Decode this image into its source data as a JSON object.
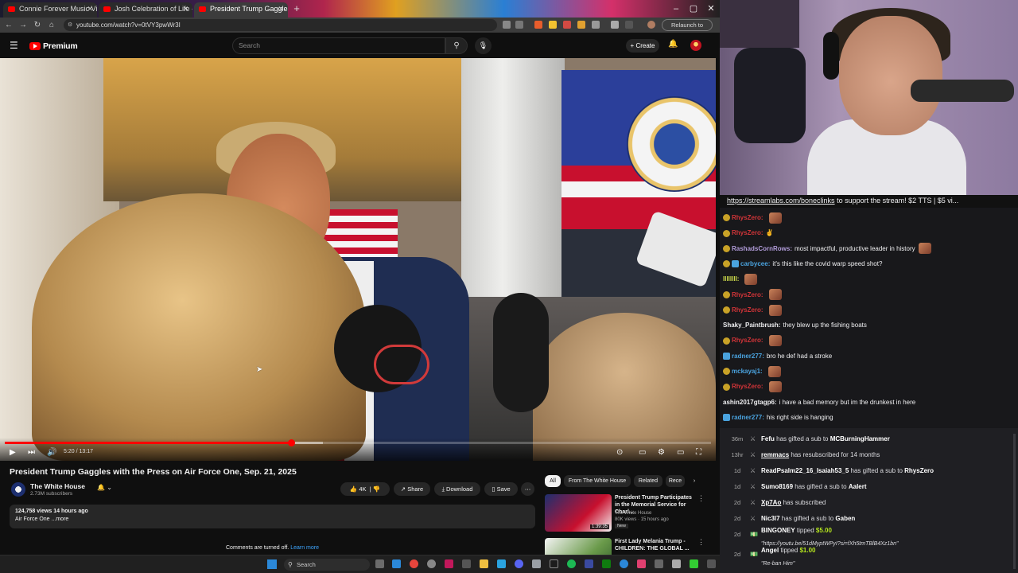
{
  "browser": {
    "tabs": [
      {
        "title": "Connie Forever Music Video -"
      },
      {
        "title": "Josh Celebration of Life - YouT"
      },
      {
        "title": "President Trump Gaggles w"
      }
    ],
    "url": "youtube.com/watch?v=0tVY3pwWr3I",
    "relaunch_label": "Relaunch to update",
    "new_tab_icon": "plus-icon"
  },
  "youtube": {
    "logo_text": "Premium",
    "search_placeholder": "Search",
    "create_label": "Create",
    "video": {
      "progress": 0.405,
      "buffered": 0.45,
      "time": "5:20 / 13:17"
    },
    "title": "President Trump Gaggles with the Press on Air Force One, Sep. 21, 2025",
    "channel": {
      "name": "The White House",
      "subscribers": "2.73M subscribers"
    },
    "actions": {
      "likes": "4K",
      "share": "Share",
      "download": "Download",
      "save": "Save"
    },
    "description": {
      "meta": "124,758 views  14 hours ago",
      "text": "Air Force One ...more"
    },
    "comments_off": "Comments are turned off.",
    "learn_more": "Learn more",
    "chips": [
      "All",
      "From The White House",
      "Related",
      "Rece"
    ],
    "related": [
      {
        "title": "President Trump Participates in the Memorial Service for Charl...",
        "channel": "The White House",
        "views": "80K views · 15 hours ago",
        "badge": "New",
        "duration": "1:39:35"
      },
      {
        "title": "First Lady Melania Trump - CHILDREN: THE GLOBAL ...",
        "channel": "",
        "views": "",
        "badge": "",
        "duration": ""
      }
    ]
  },
  "chat": {
    "banner_link": "https://streamlabs.com/boneclinks",
    "banner_text": " to support the stream! $2 TTS | $5 vi...",
    "messages": [
      {
        "user": "RhysZero:",
        "text": "",
        "user_color": "#d13438",
        "badge": "gold",
        "emote": true
      },
      {
        "user": "RhysZero:",
        "text": "✌",
        "user_color": "#d13438",
        "badge": "gold",
        "emote": false
      },
      {
        "user": "RashadsCornRows:",
        "text": "most impactful, productive leader in history",
        "user_color": "#b19cd9",
        "badge": "gold",
        "emote": true
      },
      {
        "user": "carbycee:",
        "text": "it's this like the covid warp speed shot?",
        "user_color": "#4aa3df",
        "badge": "both",
        "emote": false
      },
      {
        "user": "IIIIIIII:",
        "text": "",
        "user_color": "#c9d64a",
        "badge": "none",
        "emote": true
      },
      {
        "user": "RhysZero:",
        "text": "",
        "user_color": "#d13438",
        "badge": "gold",
        "emote": true
      },
      {
        "user": "RhysZero:",
        "text": "",
        "user_color": "#d13438",
        "badge": "gold",
        "emote": true
      },
      {
        "user": "Shaky_Paintbrush:",
        "text": "they blew up the fishing boats",
        "user_color": "#efeff1",
        "badge": "none",
        "emote": false
      },
      {
        "user": "RhysZero:",
        "text": "",
        "user_color": "#d13438",
        "badge": "gold",
        "emote": true
      },
      {
        "user": "radner277:",
        "text": "bro he def had a stroke",
        "user_color": "#4aa3df",
        "badge": "blue",
        "emote": false
      },
      {
        "user": "mckayaj1:",
        "text": "",
        "user_color": "#4aa3df",
        "badge": "gold",
        "emote": true
      },
      {
        "user": "RhysZero:",
        "text": "",
        "user_color": "#d13438",
        "badge": "gold",
        "emote": true
      },
      {
        "user": "ashin2017gtagp6:",
        "text": "i have a bad memory but im the drunkest in here",
        "user_color": "#efeff1",
        "badge": "none",
        "emote": false
      },
      {
        "user": "radner277:",
        "text": "his right side is hanging",
        "user_color": "#4aa3df",
        "badge": "blue",
        "emote": false
      }
    ]
  },
  "events": [
    {
      "time": "36m",
      "user": "Fefu",
      "mid": " has gifted a sub to ",
      "target": "MCBurningHammer",
      "extra": ""
    },
    {
      "time": "13hr",
      "user": "remmacs",
      "mid": " has resubscribed for 14 months",
      "target": "",
      "extra": "",
      "underline": true
    },
    {
      "time": "1d",
      "user": "ReadPsalm22_16_Isaiah53_5",
      "mid": " has gifted a sub to ",
      "target": "RhysZero",
      "extra": ""
    },
    {
      "time": "1d",
      "user": "Sumo8169",
      "mid": " has gifted a sub to ",
      "target": "Aalert",
      "extra": ""
    },
    {
      "time": "2d",
      "user": "Xp7Ao",
      "mid": " has subscribed",
      "target": "",
      "extra": "",
      "underline": true
    },
    {
      "time": "2d",
      "user": "Nic3l7",
      "mid": " has gifted a sub to ",
      "target": "Gaben",
      "extra": ""
    },
    {
      "time": "2d",
      "user": "BINGONEY",
      "mid": " tipped ",
      "target": "$5.00",
      "extra": "\"https://youtu.be/51dMyptWPyI?si=fXh5tmTBlB4Xz1bn\"",
      "target_color": "#b5e61d"
    },
    {
      "time": "2d",
      "user": "Angel",
      "mid": " tipped ",
      "target": "$1.00",
      "extra": "\"Re-ban Him\"",
      "target_color": "#b5e61d"
    }
  ],
  "taskbar": {
    "search_placeholder": "Search"
  }
}
